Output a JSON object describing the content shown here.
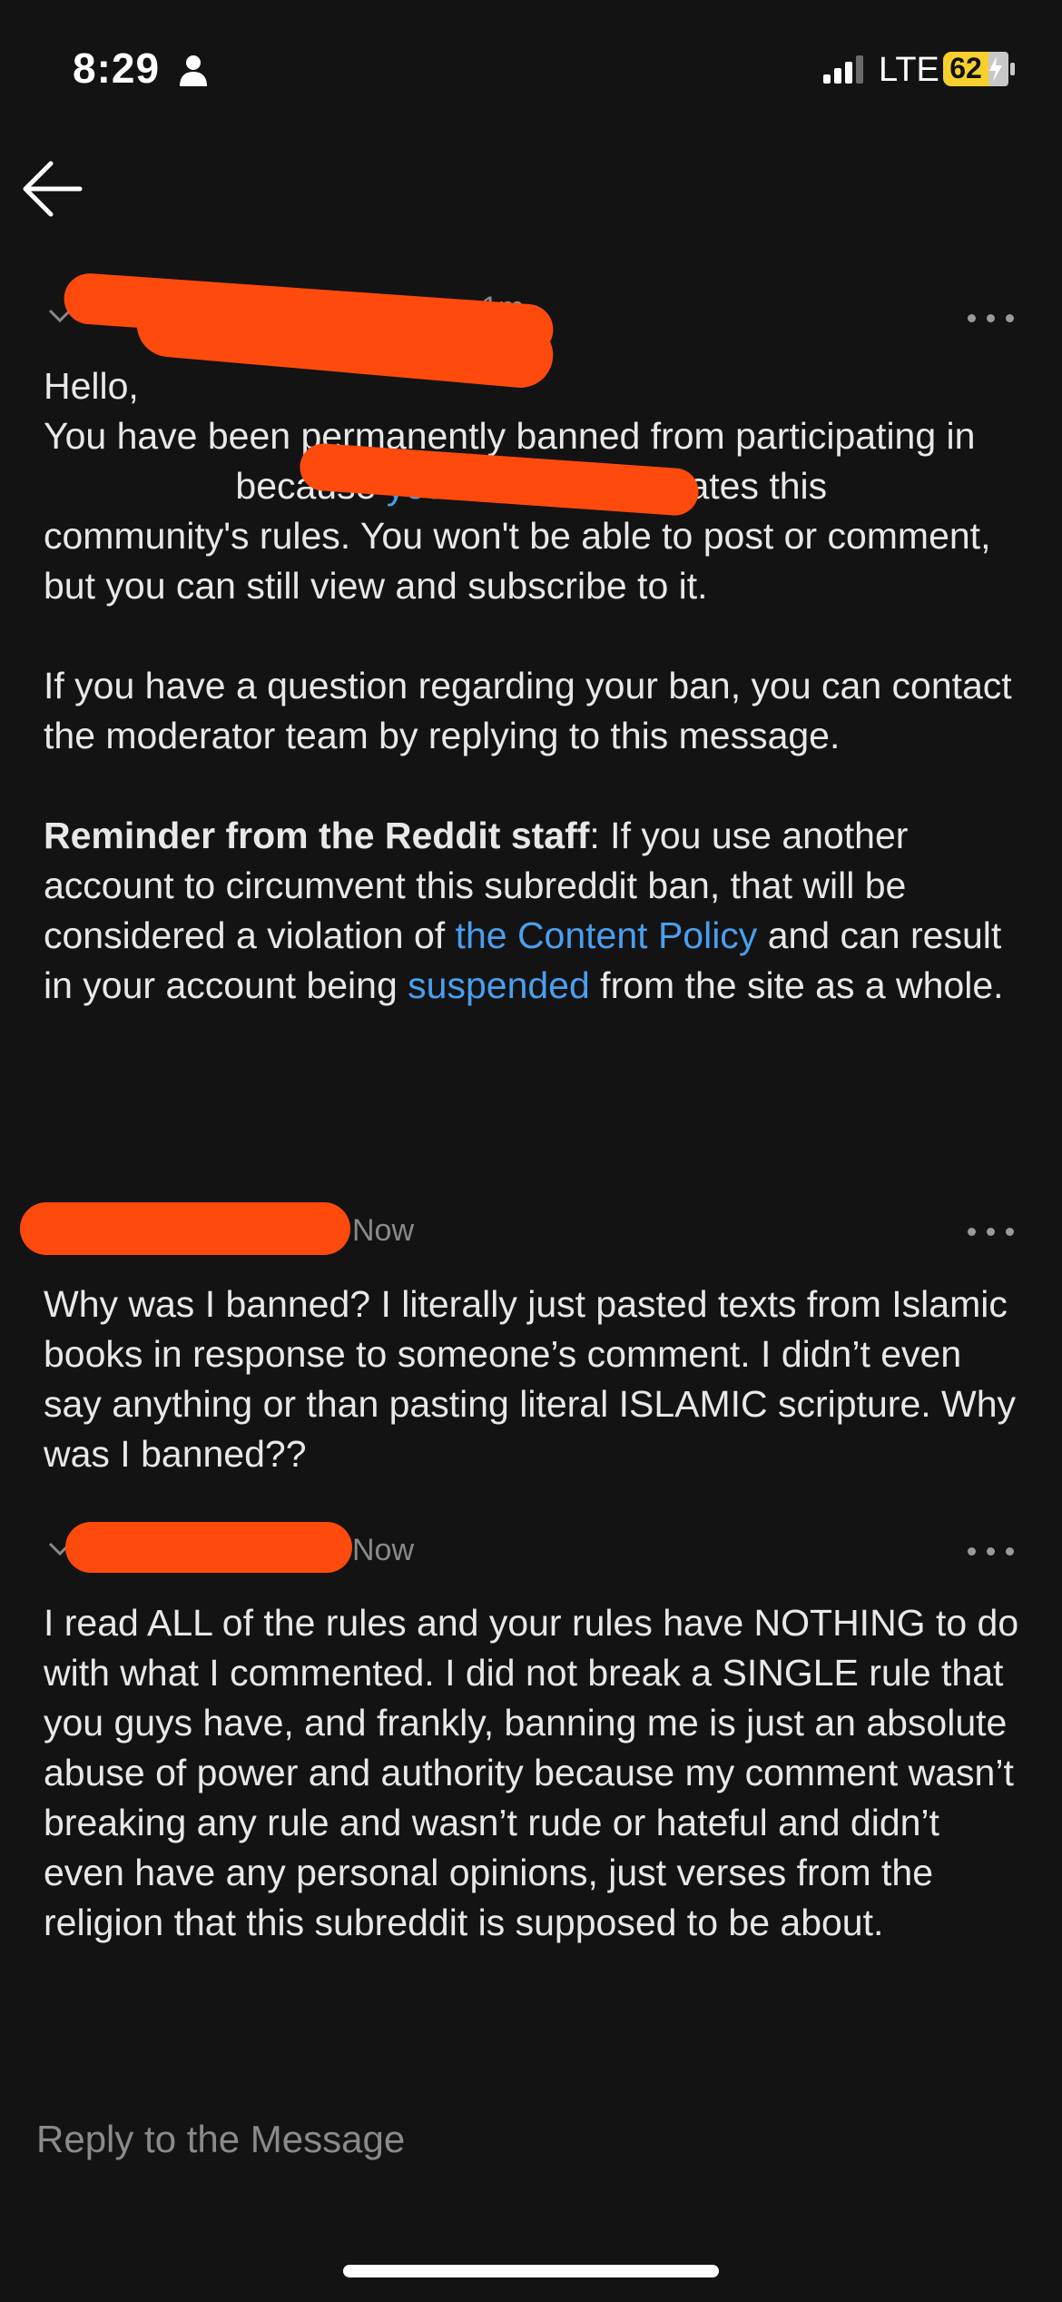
{
  "status_bar": {
    "time": "8:29",
    "network": "LTE",
    "battery": "62"
  },
  "messages": [
    {
      "timestamp": "1m",
      "paragraphs": {
        "greeting": "Hello,",
        "p1_a": "You have been permanently banned from participating in ",
        "p1_b": " because ",
        "p1_link": "your comment",
        "p1_c": " violates this community's rules. You won't be able to post or comment, but you can still view and subscribe to it.",
        "p2": "If you have a question regarding your ban, you can contact the moderator team by replying to this message.",
        "p3_bold": "Reminder from the Reddit staff",
        "p3_a": ": If you use another account to circumvent this subreddit ban, that will be considered a violation of ",
        "p3_link1": "the Content Policy",
        "p3_b": " and can result in your account being ",
        "p3_link2": "suspended",
        "p3_c": " from the site as a whole."
      }
    },
    {
      "timestamp": "Now",
      "text": "Why was I banned? I literally just pasted texts from Islamic books in response to someone’s comment. I didn’t even say anything or than pasting literal ISLAMIC scripture. Why was I banned??"
    },
    {
      "timestamp": "Now",
      "text": "I read ALL of the rules and your rules have NOTHING to do with what I commented. I did not break a SINGLE rule that you guys have, and frankly, banning me is just an absolute abuse of power and authority because my comment wasn’t breaking any rule and wasn’t rude or hateful and didn’t even have any personal opinions, just verses from the religion that this subreddit is supposed to be about."
    }
  ],
  "reply_placeholder": "Reply to the Message",
  "colors": {
    "background": "#131313",
    "text": "#e8e8e8",
    "link": "#4a9ff0",
    "muted": "#8a8a8a",
    "redaction": "#ff4a0e",
    "battery": "#f7cf2e"
  },
  "icons": [
    "person-icon",
    "signal-icon",
    "battery-icon",
    "back-arrow-icon",
    "collapse-chevron-icon",
    "more-options-icon"
  ]
}
